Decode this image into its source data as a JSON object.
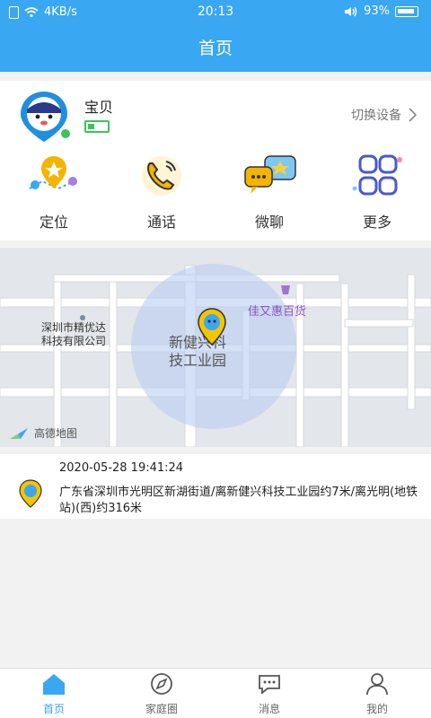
{
  "status_bar": {
    "network_speed": "4KB/s",
    "time": "20:13",
    "battery_percent": "93%"
  },
  "header": {
    "title": "首页"
  },
  "device": {
    "name": "宝贝",
    "switch_label": "切换设备",
    "battery_level": 0.35,
    "online_color": "#3cc45a"
  },
  "actions": [
    {
      "label": "定位",
      "icon": "location-map-icon"
    },
    {
      "label": "通话",
      "icon": "phone-call-icon"
    },
    {
      "label": "微聊",
      "icon": "chat-bubbles-icon"
    },
    {
      "label": "更多",
      "icon": "more-grid-icon"
    }
  ],
  "map": {
    "poi_shop": "佳又惠百货",
    "company_label_line1": "深圳市精优达",
    "company_label_line2": "科技有限公司",
    "park_label_line1": "新健兴科",
    "park_label_line2": "技工业园",
    "provider": "高德地图"
  },
  "location": {
    "timestamp": "2020-05-28 19:41:24",
    "address": "广东省深圳市光明区新湖街道/离新健兴科技工业园约7米/离光明(地铁站)(西)约316米"
  },
  "tabs": [
    {
      "label": "首页",
      "icon": "home-icon",
      "active": true
    },
    {
      "label": "家庭圈",
      "icon": "compass-icon",
      "active": false
    },
    {
      "label": "消息",
      "icon": "message-icon",
      "active": false
    },
    {
      "label": "我的",
      "icon": "user-icon",
      "active": false
    }
  ],
  "colors": {
    "primary": "#3aa7f2",
    "pin_yellow": "#f5c400"
  }
}
